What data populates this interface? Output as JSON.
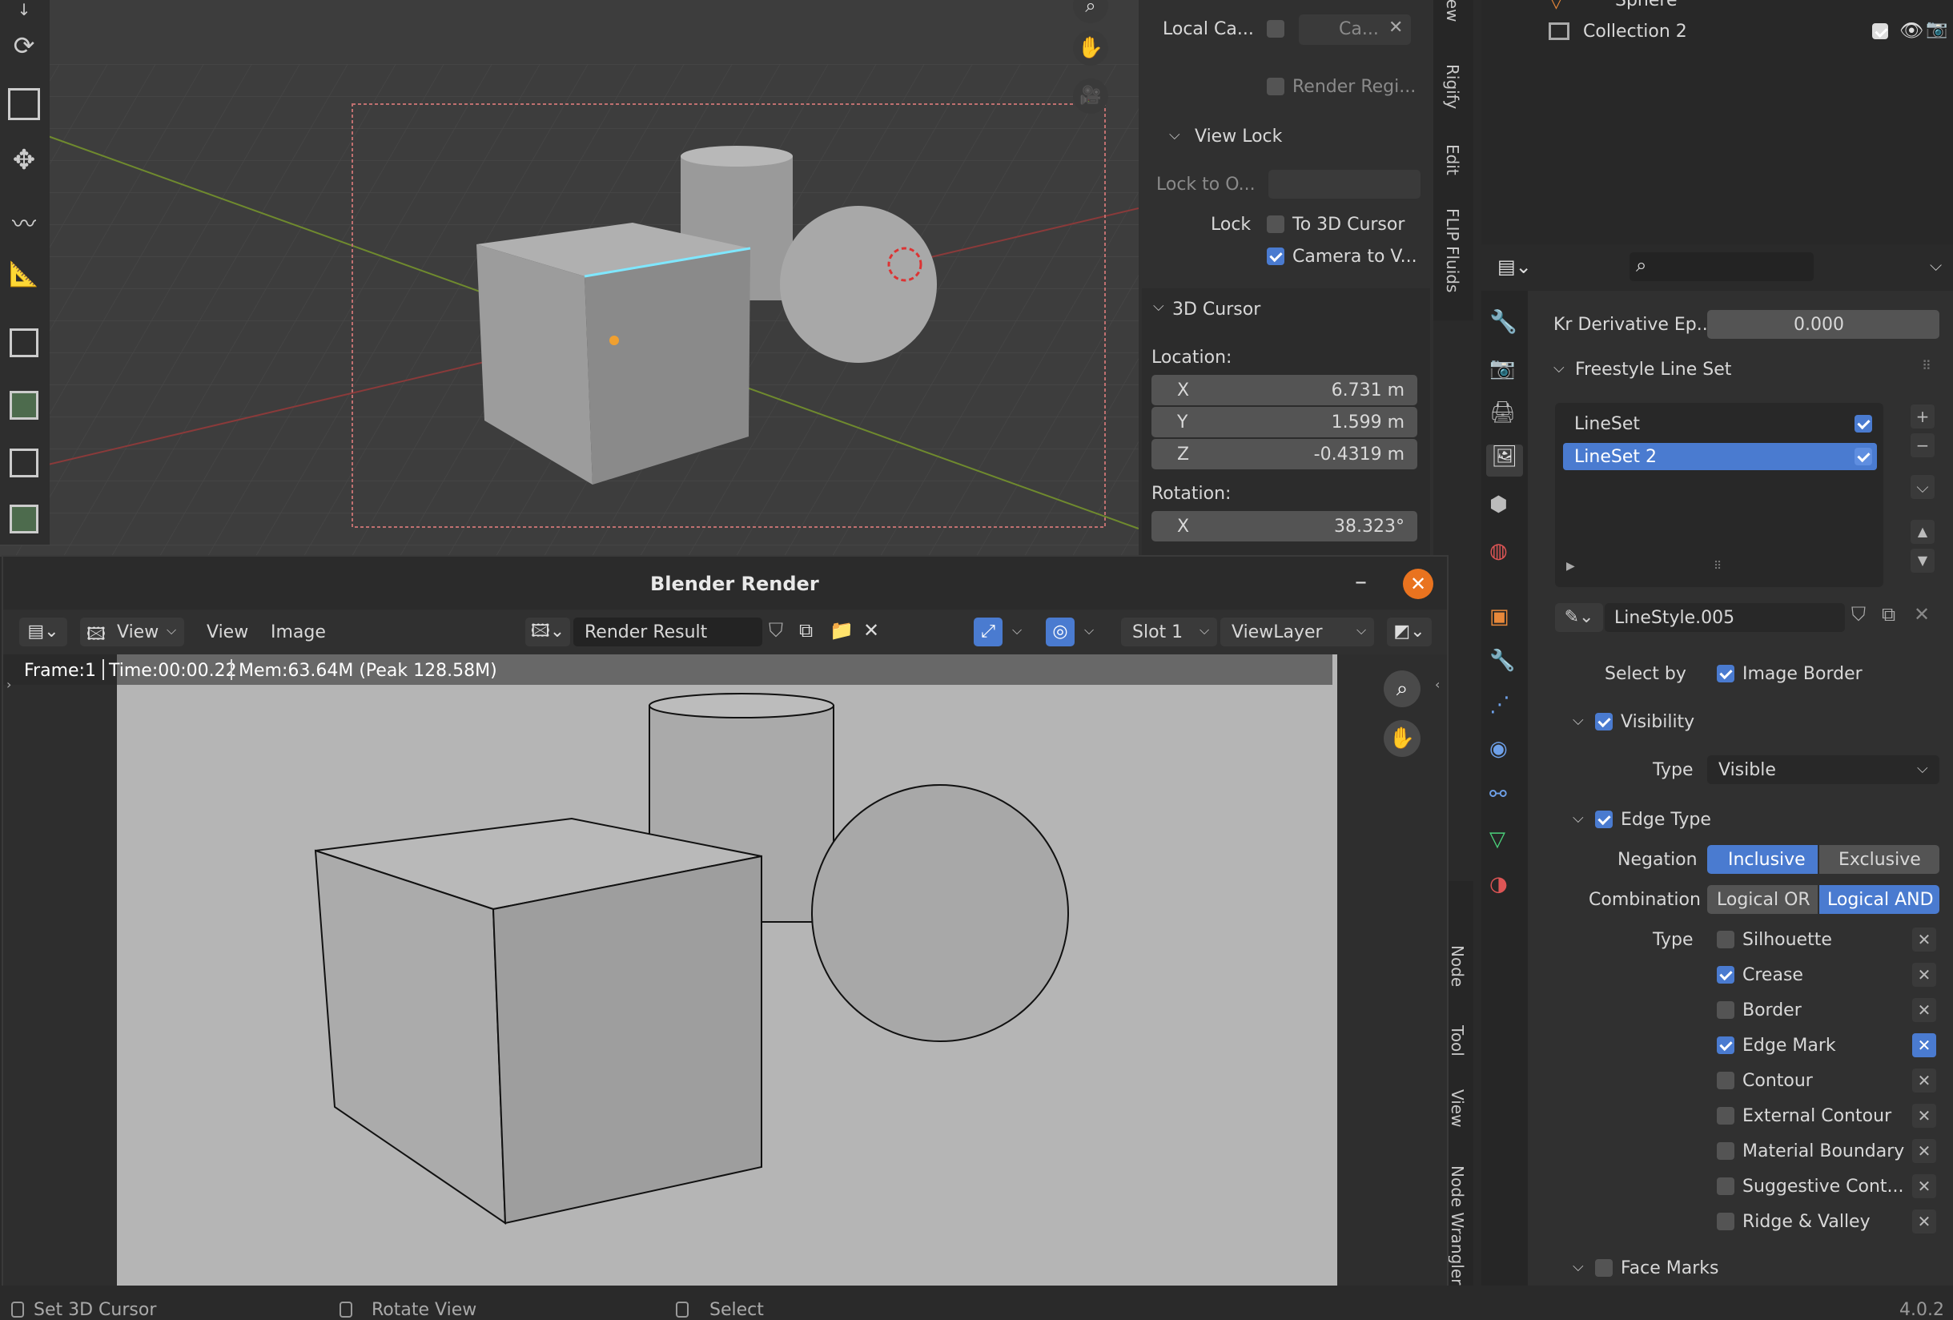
{
  "viewport_top_panel": {
    "local_camera_label": "Local Ca...",
    "local_camera_value": "Ca...",
    "render_region_label": "Render Regi...",
    "view_lock_header": "View Lock",
    "lock_to_object_label": "Lock to O...",
    "lock_label": "Lock",
    "to_3d_cursor_label": "To 3D Cursor",
    "camera_to_view_label": "Camera to V...",
    "cursor_header": "3D Cursor",
    "location_label": "Location:",
    "loc_x_label": "X",
    "loc_x": "6.731 m",
    "loc_y_label": "Y",
    "loc_y": "1.599 m",
    "loc_z_label": "Z",
    "loc_z": "-0.4319 m",
    "rotation_label": "Rotation:",
    "rot_x_label": "X",
    "rot_x": "38.323°"
  },
  "side_tabs_top": [
    "View",
    "Rigify",
    "Edit",
    "FLIP Fluids"
  ],
  "side_tabs_bottom": [
    "Node",
    "Tool",
    "View",
    "Node Wrangler"
  ],
  "outliner": {
    "item_sphere": "Sphere",
    "item_collection2": "Collection 2"
  },
  "properties": {
    "kr_derivative_label": "Kr Derivative Ep...",
    "kr_derivative_value": "0.000",
    "freestyle_lineset_header": "Freestyle Line Set",
    "linesets": [
      "LineSet",
      "LineSet 2"
    ],
    "linestyle_name": "LineStyle.005",
    "select_by_label": "Select by",
    "image_border_label": "Image Border",
    "visibility_header": "Visibility",
    "type_label": "Type",
    "type_value": "Visible",
    "edge_type_header": "Edge Type",
    "negation_label": "Negation",
    "negation_options": [
      "Inclusive",
      "Exclusive"
    ],
    "combination_label": "Combination",
    "combination_options": [
      "Logical OR",
      "Logical AND"
    ],
    "edge_type_label": "Type",
    "edge_types": [
      "Silhouette",
      "Crease",
      "Border",
      "Edge Mark",
      "Contour",
      "External Contour",
      "Material Boundary",
      "Suggestive Cont...",
      "Ridge & Valley"
    ],
    "face_marks_header": "Face Marks"
  },
  "render_window": {
    "title": "Blender Render",
    "menu_view1": "View",
    "menu_view2": "View",
    "menu_image": "Image",
    "image_name": "Render Result",
    "slot": "Slot 1",
    "view_layer": "ViewLayer",
    "frame_info": "Frame:1",
    "time_info": "Time:00:00.22",
    "mem_info": "Mem:63.64M (Peak 128.58M)"
  },
  "status_bar": {
    "set_cursor": "Set 3D Cursor",
    "rotate_view": "Rotate View",
    "select": "Select",
    "version": "4.0.2"
  },
  "colors": {
    "accent": "#4a7bd0",
    "close_button": "#e9731f",
    "panel_bg": "#303030"
  }
}
